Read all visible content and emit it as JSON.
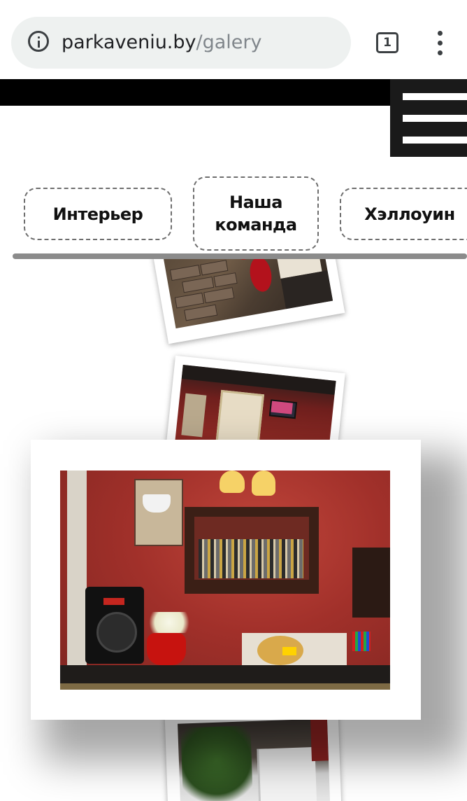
{
  "browser": {
    "url_host": "parkaveniu.by",
    "url_path": "/galery",
    "tab_count": "1"
  },
  "categories": [
    {
      "label": "Интерьер"
    },
    {
      "label": "Наша команда"
    },
    {
      "label": "Хэллоуин"
    }
  ],
  "gallery": {
    "photos": [
      {
        "subject": "brick-wall-red-lamp"
      },
      {
        "subject": "red-room-with-tv"
      },
      {
        "subject": "bar-shelf-with-speaker-and-pumpkin"
      },
      {
        "subject": "plant-by-window"
      }
    ]
  },
  "colors": {
    "header_bar": "#000000",
    "urlbar_bg": "#eef1f0",
    "category_border": "#6e6e6e"
  }
}
